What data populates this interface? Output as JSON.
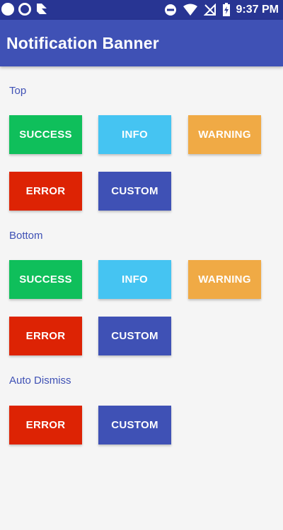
{
  "status_bar": {
    "time": "9:37 PM",
    "left_icons": [
      "notification-dot-icon",
      "notification-ring-icon",
      "app-notification-icon"
    ],
    "right_icons": [
      "do-not-disturb-icon",
      "wifi-icon",
      "no-signal-icon",
      "battery-charging-icon"
    ]
  },
  "app_bar": {
    "title": "Notification Banner"
  },
  "colors": {
    "success": "#0fbf5b",
    "info": "#45c4f2",
    "warning": "#f0aa45",
    "error": "#dd2304",
    "custom": "#3f51b5"
  },
  "sections": {
    "top": {
      "label": "Top",
      "success": "SUCCESS",
      "info": "INFO",
      "warning": "WARNING",
      "error": "ERROR",
      "custom": "CUSTOM"
    },
    "bottom": {
      "label": "Bottom",
      "success": "SUCCESS",
      "info": "INFO",
      "warning": "WARNING",
      "error": "ERROR",
      "custom": "CUSTOM"
    },
    "auto_dismiss": {
      "label": "Auto Dismiss",
      "error": "ERROR",
      "custom": "CUSTOM"
    }
  }
}
